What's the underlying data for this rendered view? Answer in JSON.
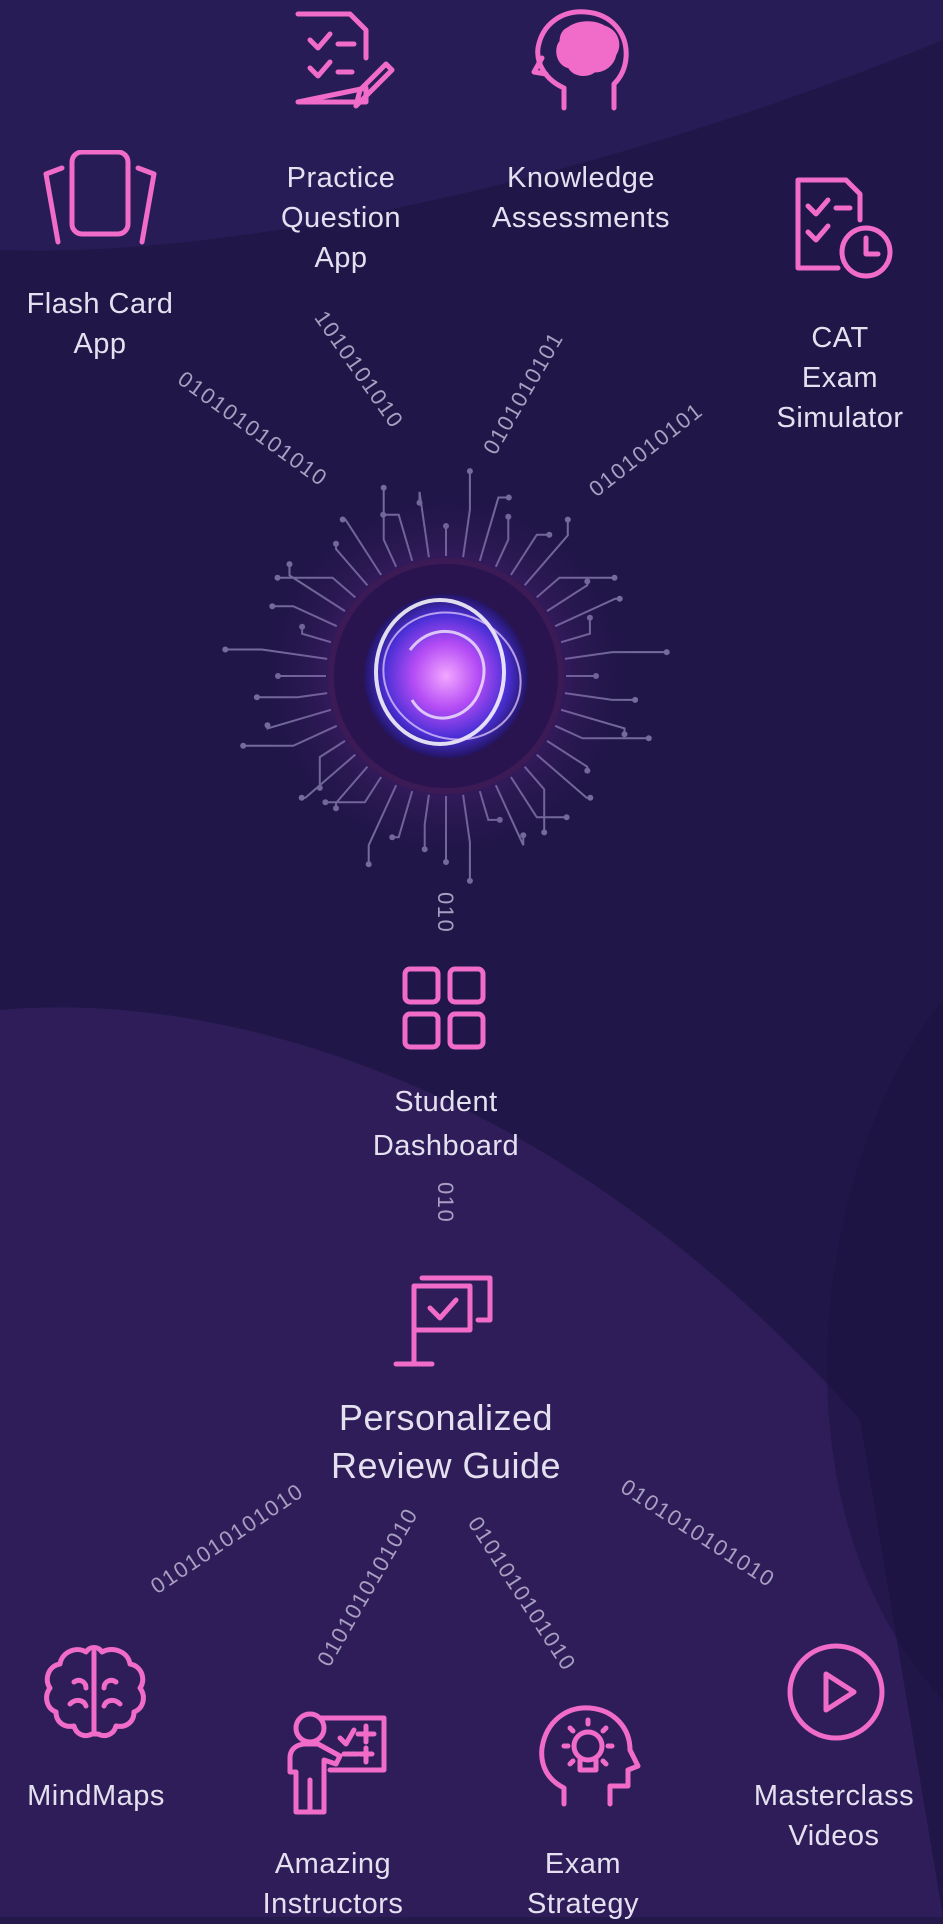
{
  "colors": {
    "background": "#23194a",
    "accent_pink": "#f06cc8",
    "text": "#e4e0f0",
    "binary": "#a79fc2",
    "circuit": "#8a82b0"
  },
  "top_items": [
    {
      "label": "Flash Card\nApp",
      "icon": "flash-cards-icon"
    },
    {
      "label": "Practice\nQuestion\nApp",
      "icon": "checklist-pencil-icon"
    },
    {
      "label": "Knowledge\nAssessments",
      "icon": "brain-head-icon"
    },
    {
      "label": "CAT Exam\nSimulator",
      "icon": "checklist-clock-icon"
    }
  ],
  "binary_top": [
    "0101010101010",
    "1010101010",
    "0101010101",
    "0101010101"
  ],
  "center": {
    "icon": "ai-orb-icon"
  },
  "binary_mid_1": "010",
  "dashboard": {
    "label": "Student\nDashboard",
    "icon": "grid-icon"
  },
  "binary_mid_2": "010",
  "review": {
    "label": "Personalized\nReview Guide",
    "icon": "presentation-board-icon"
  },
  "binary_bottom": [
    "0101010101010",
    "0101010101010",
    "0101010101010",
    "0101010101010"
  ],
  "bottom_items": [
    {
      "label": "MindMaps",
      "icon": "brain-icon"
    },
    {
      "label": "Amazing\nInstructors",
      "icon": "instructor-icon"
    },
    {
      "label": "Exam\nStrategy",
      "icon": "lightbulb-head-icon"
    },
    {
      "label": "Masterclass\nVideos",
      "icon": "play-circle-icon"
    }
  ]
}
